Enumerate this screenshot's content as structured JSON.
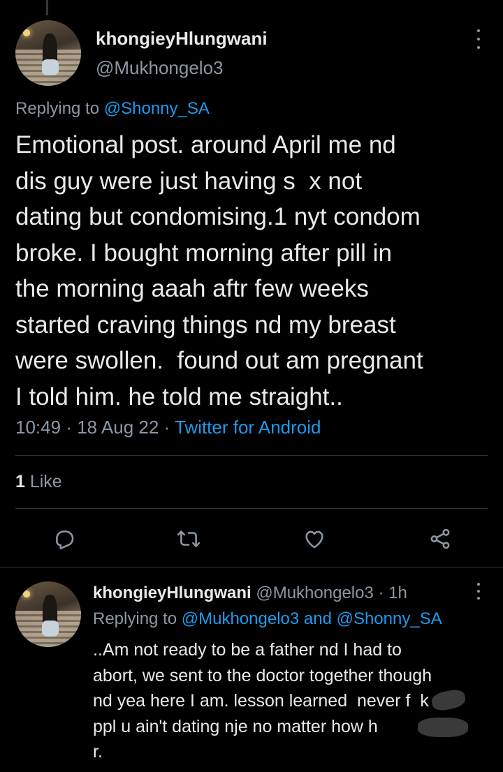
{
  "tweet": {
    "author": {
      "display_name": "khongieyHlungwani",
      "handle": "@Mukhongelo3"
    },
    "replying_prefix": "Replying to ",
    "replying_to": "@Shonny_SA",
    "text": "Emotional post. around April me nd\ndis guy were just having s  x not\ndating but condomising.1 nyt condom\nbroke. I bought morning after pill in\nthe morning aaah aftr few weeks\nstarted craving things nd my breast\nwere swollen.  found out am pregnant\nI told him. he told me straight..",
    "time": "10:49",
    "separator": " · ",
    "date": "18 Aug 22",
    "client": "Twitter for Android",
    "likes_count": "1",
    "likes_label": " Like"
  },
  "actions": {
    "reply_icon": "reply-icon",
    "retweet_icon": "retweet-icon",
    "like_icon": "heart-icon",
    "share_icon": "share-icon"
  },
  "reply": {
    "display_name": "khongieyHlungwani",
    "handle": " @Mukhongelo3",
    "separator": " · ",
    "time_ago": "1h",
    "replying_prefix": "Replying to ",
    "replying_to_1": "@Mukhongelo3",
    "replying_and": " and ",
    "replying_to_2": "@Shonny_SA",
    "text": "..Am not ready to be a father nd I had to\nabort, we sent to the doctor together though\nnd yea here I am. lesson learned  never f  k\nppl u ain't dating nje no matter how h      \nr."
  },
  "colors": {
    "background": "#000000",
    "text_primary": "#e7e9ea",
    "text_secondary": "#8b98a5",
    "accent": "#1d9bf0",
    "divider": "#2f3336"
  }
}
